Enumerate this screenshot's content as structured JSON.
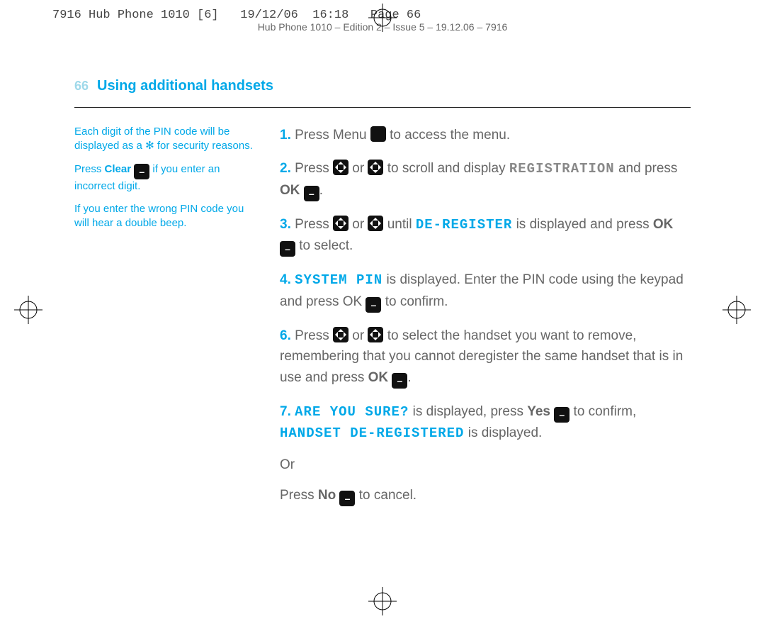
{
  "slug_top": "7916 Hub Phone 1010 [6]   19/12/06  16:18   Page 66",
  "slug_sub": "Hub Phone 1010 – Edition 2 – Issue 5 – 19.12.06 – 7916",
  "page_number": "66",
  "heading": "Using additional handsets",
  "side": {
    "note1a": "Each digit of the PIN code will be displayed as a ",
    "note1b": " for security reasons.",
    "star": "✻",
    "note2_pre": "Press ",
    "note2_clear": "Clear",
    "note2_post": " if you enter an incorrect digit.",
    "note3": "If you enter the wrong PIN code you will hear a double beep."
  },
  "steps": {
    "s1": {
      "n": "1.",
      "t_pre": "Press Menu ",
      "t_post": " to access the menu."
    },
    "s2": {
      "n": "2.",
      "t1": "Press ",
      "t2": " or ",
      "t3": " to scroll and display ",
      "lcd": "REGISTRATION",
      "t4": " and press ",
      "ok": "OK",
      "t5": "."
    },
    "s3": {
      "n": "3.",
      "t1": "Press ",
      "t2": " or ",
      "t3": " until ",
      "lcd": "DE-REGISTER",
      "t4": " is displayed and press ",
      "ok": "OK",
      "t5": " to select."
    },
    "s4": {
      "n": "4.",
      "lcd": "SYSTEM PIN",
      "t1": " is displayed. Enter the PIN code using the keypad and press OK ",
      "t2": " to confirm."
    },
    "s6": {
      "n": "6.",
      "t1": "Press ",
      "t2": " or ",
      "t3": " to select the handset you want to remove, remembering that you cannot deregister the same handset that is in use and press ",
      "ok": "OK",
      "t4": "."
    },
    "s7": {
      "n": "7.",
      "lcd1": "ARE YOU SURE?",
      "t1": " is displayed, press ",
      "yes": "Yes",
      "t2": " to confirm, ",
      "lcd2": "HANDSET DE-REGISTERED",
      "t3": " is displayed.",
      "or": "Or",
      "t4_pre": "Press ",
      "no": "No",
      "t4_post": " to cancel."
    }
  }
}
